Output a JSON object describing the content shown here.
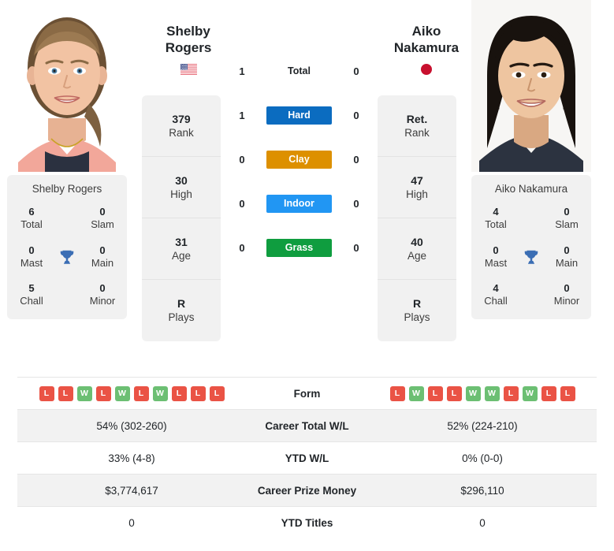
{
  "players": {
    "left": {
      "name_line1": "Shelby",
      "name_line2": "Rogers",
      "full_name": "Shelby Rogers",
      "flag": "flag-us",
      "flag_country": "United States",
      "rank": "379",
      "rank_label": "Rank",
      "high": "30",
      "high_label": "High",
      "age": "31",
      "age_label": "Age",
      "plays": "R",
      "plays_label": "Plays",
      "titles": {
        "total": "6",
        "total_label": "Total",
        "slam": "0",
        "slam_label": "Slam",
        "mast": "0",
        "mast_label": "Mast",
        "main": "0",
        "main_label": "Main",
        "chall": "5",
        "chall_label": "Chall",
        "minor": "0",
        "minor_label": "Minor"
      },
      "form": [
        "L",
        "L",
        "W",
        "L",
        "W",
        "L",
        "W",
        "L",
        "L",
        "L"
      ],
      "career_wl": "54% (302-260)",
      "ytd_wl": "33% (4-8)",
      "career_prize": "$3,774,617",
      "ytd_titles": "0"
    },
    "right": {
      "name_line1": "Aiko",
      "name_line2": "Nakamura",
      "full_name": "Aiko Nakamura",
      "flag": "flag-jp",
      "flag_country": "Japan",
      "rank": "Ret.",
      "rank_label": "Rank",
      "high": "47",
      "high_label": "High",
      "age": "40",
      "age_label": "Age",
      "plays": "R",
      "plays_label": "Plays",
      "titles": {
        "total": "4",
        "total_label": "Total",
        "slam": "0",
        "slam_label": "Slam",
        "mast": "0",
        "mast_label": "Mast",
        "main": "0",
        "main_label": "Main",
        "chall": "4",
        "chall_label": "Chall",
        "minor": "0",
        "minor_label": "Minor"
      },
      "form": [
        "L",
        "W",
        "L",
        "L",
        "W",
        "W",
        "L",
        "W",
        "L",
        "L"
      ],
      "career_wl": "52% (224-210)",
      "ytd_wl": "0% (0-0)",
      "career_prize": "$296,110",
      "ytd_titles": "0"
    }
  },
  "h2h": {
    "total": {
      "label": "Total",
      "left": "1",
      "right": "0"
    },
    "surfaces": [
      {
        "label": "Hard",
        "left": "1",
        "right": "0",
        "color": "#0b6cc0"
      },
      {
        "label": "Clay",
        "left": "0",
        "right": "0",
        "color": "#dd9000"
      },
      {
        "label": "Indoor",
        "left": "0",
        "right": "0",
        "color": "#2196f3"
      },
      {
        "label": "Grass",
        "left": "0",
        "right": "0",
        "color": "#0f9d3f"
      }
    ]
  },
  "table": {
    "rows": [
      {
        "label": "Form",
        "type": "form"
      },
      {
        "label": "Career Total W/L",
        "type": "text",
        "left": "54% (302-260)",
        "right": "52% (224-210)"
      },
      {
        "label": "YTD W/L",
        "type": "text",
        "left": "33% (4-8)",
        "right": "0% (0-0)"
      },
      {
        "label": "Career Prize Money",
        "type": "text",
        "left": "$3,774,617",
        "right": "$296,110"
      },
      {
        "label": "YTD Titles",
        "type": "text",
        "left": "0",
        "right": "0"
      }
    ]
  },
  "colors": {
    "win": "#6cbf73",
    "loss": "#ea5345",
    "trophy": "#3b6eb4",
    "panel": "#f1f1f1",
    "row_shade": "#f2f2f2"
  }
}
